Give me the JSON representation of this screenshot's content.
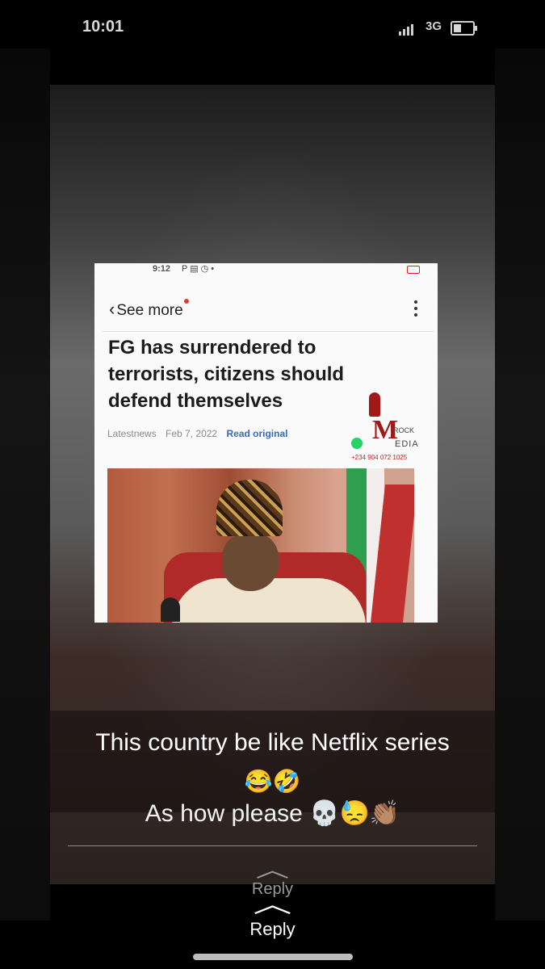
{
  "status_bar": {
    "time": "10:01",
    "network": "3G",
    "battery_level": 0.4
  },
  "embedded_screenshot": {
    "status_time": "9:12",
    "status_icons": "P ▤ ◷ •",
    "back_label": "See more",
    "headline": "FG has surrendered to terrorists, citizens should defend themselves",
    "source": "Latestnews",
    "date": "Feb 7, 2022",
    "read_original": "Read original",
    "watermark": {
      "rock": "ROCK",
      "edia": "EDIA",
      "phone": "+234 904 072 1025"
    }
  },
  "caption": {
    "line1": "This country be like Netflix series",
    "emoji1": "😂🤣",
    "line2": "As how please 💀😓👏🏽"
  },
  "reply": {
    "ghost_label": "Reply",
    "label": "Reply"
  },
  "colors": {
    "accent_link": "#3b6ab5",
    "notification_dot": "#e53935"
  }
}
